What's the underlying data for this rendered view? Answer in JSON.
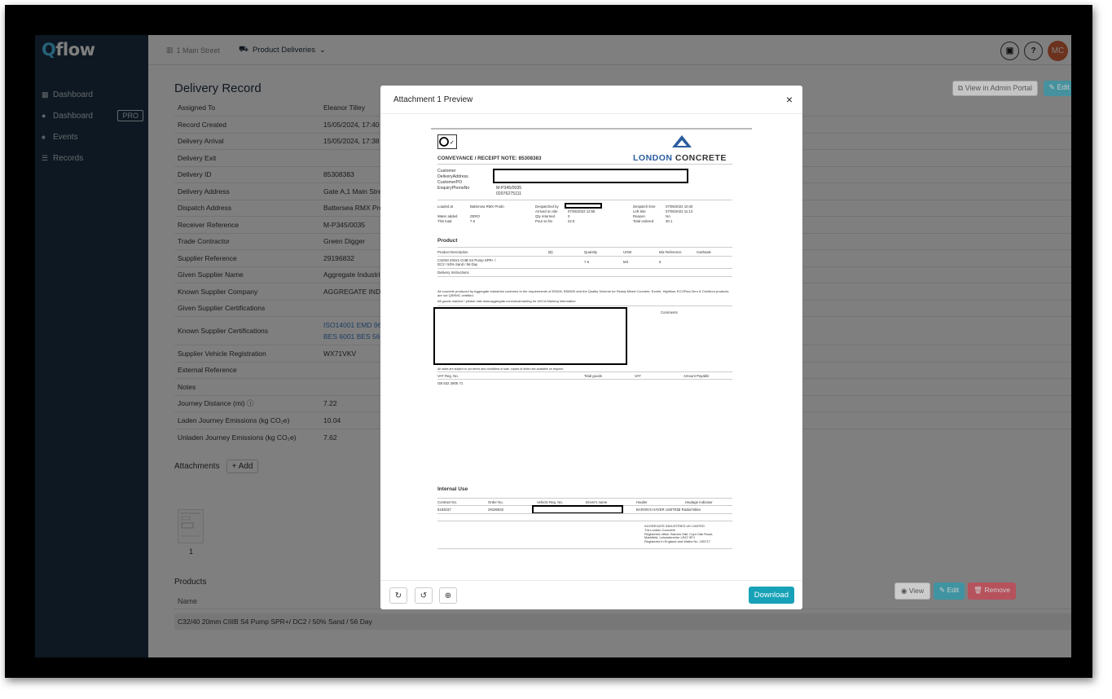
{
  "app": {
    "logo_q": "Q",
    "logo_rest": "flow",
    "sidebar": [
      {
        "label": "Dashboard",
        "badge": ""
      },
      {
        "label": "Dashboard",
        "badge": "PRO"
      },
      {
        "label": "Events",
        "badge": ""
      },
      {
        "label": "Records",
        "badge": ""
      }
    ],
    "breadcrumb_site": "1 Main Street",
    "breadcrumb_module": "Product Deliveries",
    "avatar_initials": "MC",
    "help_label": "?"
  },
  "record": {
    "title": "Delivery Record",
    "admin_button": "View in Admin Portal",
    "edit_button": "Edit",
    "rows": [
      {
        "k": "Assigned To",
        "v": "Eleanor Tilley"
      },
      {
        "k": "Record Created",
        "v": "15/05/2024, 17:40"
      },
      {
        "k": "Delivery Arrival",
        "v": "15/05/2024, 17:38"
      },
      {
        "k": "Delivery Exit",
        "v": ""
      },
      {
        "k": "Delivery ID",
        "v": "85308383"
      },
      {
        "k": "Delivery Address",
        "v": "Gate A,1 Main Stre"
      },
      {
        "k": "Dispatch Address",
        "v": "Battersea RMX Pro"
      },
      {
        "k": "Receiver Reference",
        "v": "M-P345/0035"
      },
      {
        "k": "Trade Contractor",
        "v": "Green Digger"
      },
      {
        "k": "Supplier Reference",
        "v": "29196832"
      },
      {
        "k": "Given Supplier Name",
        "v": "Aggregate Industrie"
      },
      {
        "k": "Known Supplier Company",
        "v": "AGGREGATE INDUS"
      },
      {
        "k": "Given Supplier Certifications",
        "v": ""
      },
      {
        "k": "Known Supplier Certifications",
        "v": "ISO14001 EMD 96",
        "v2": "BES 6001 BES 563"
      },
      {
        "k": "Supplier Vehicle Registration",
        "v": "WX71VKV"
      },
      {
        "k": "External Reference",
        "v": ""
      },
      {
        "k": "Notes",
        "v": ""
      },
      {
        "k": "Journey Distance (mi)",
        "v": "7.22"
      },
      {
        "k": "Laden Journey Emissions (kg CO₂e)",
        "v": "10.04"
      },
      {
        "k": "Unladen Journey Emissions (kg CO₂e)",
        "v": "7.62"
      }
    ],
    "attachments_label": "Attachments",
    "add_label": "Add",
    "attachment_number": "1",
    "products_label": "Products",
    "products_name_header": "Name",
    "products_extra_header": "e)",
    "product_name": "C32/40 20mm CIIIB S4 Pump SPR+/ DC2 / 50% Sand / 56 Day",
    "view_label": "View",
    "edit_label": "Edit",
    "remove_label": "Remove"
  },
  "modal": {
    "title": "Attachment 1 Preview",
    "close": "×",
    "download": "Download",
    "doc": {
      "heading": "CONVEYANCE / RECEIPT NOTE: 85308383",
      "brand_a": "LONDON",
      "brand_b": "CONCRETE",
      "customer_labels": [
        "Customer",
        "DeliveryAddress",
        "CustomerPO",
        "EnquiryPhoneNo"
      ],
      "customer_values": [
        "",
        "",
        "M-P345/0035",
        "02076275111"
      ],
      "loaded_at_label": "Loaded at",
      "loaded_at": "Battersea RMX Prodn",
      "water_label": "Water added",
      "water": "ZERO",
      "this_load_label": "This load",
      "this_load": "7.5",
      "despatched_label": "Despatched by",
      "arrived_label": "Arrived on site",
      "arrived": "07/05/2022 12:55",
      "qty_returned_label": "Qty returned",
      "qty_returned": "0",
      "pour_label": "Pour so far",
      "pour": "22.5",
      "despatch_time_label": "Despatch time",
      "despatch_time": "07/05/2022 10:40",
      "left_site_label": "Left Site",
      "left_site": "07/05/2022 11:13",
      "reason_label": "Reason",
      "reason": "NA",
      "total_ordered_label": "Total ordered",
      "total_ordered": "30.1",
      "product_heading": "Product",
      "product_cols": [
        "Product Description",
        "(B)",
        "Quantity",
        "UOM",
        "Mix Reference",
        "Cashsale"
      ],
      "product_desc": "C32/40 20mm CIIIB S4 Pump SPR+ / DC2 / 50% Sand / 56 Day",
      "product_qty": "7.5",
      "product_uom": "M3",
      "product_mix": "5",
      "delivery_instructions": "Delivery Instructions",
      "conform_text": "All concrete produced by Aggregate Industries conforms to the requirements of EN206, BS8500 and the Quality Scheme for Ready Mixed Concrete. Ecrete, Highflow, ECOPact Zero & Cemfloor products are not QSRMC certified.",
      "ukca_text": "All goods marked * please visit www.aggregate.com/ukcamarking for UKCA Marking information",
      "comments": "Comments",
      "terms": "All sales are subject to our terms and conditions of sale, copies of which are available on request.",
      "vat_cols": [
        "VAT Reg. No.",
        "Total goods",
        "VAT",
        "Amount Payable"
      ],
      "vat_no": "GB 532 2805 71",
      "internal_use": "Internal Use",
      "internal_cols": [
        "Contract No.",
        "Order No.",
        "Vehicle Reg. No.",
        "Driver's name",
        "Haulier",
        "Haulage Indicator"
      ],
      "contract_no": "5183037",
      "order_no": "29196832",
      "haulier": "BARON'S HAVER LIMITED",
      "haulage": "2 Radial Miles",
      "footer_lines": [
        "AGGREGATE INDUSTRIES UK LIMITED",
        "T/A London Concrete",
        "Registered office: Bardon Hall, Copt Oak Road,",
        "Markfield, Leicestershire LE67 9PJ",
        "Registered in England and Wales No. 245717"
      ]
    }
  },
  "colors": {
    "sidebar": "#1c3144",
    "accent": "#17a2b8",
    "danger": "#dc3545",
    "avatar": "#d8653a",
    "brand_blue": "#2a5d9f"
  }
}
